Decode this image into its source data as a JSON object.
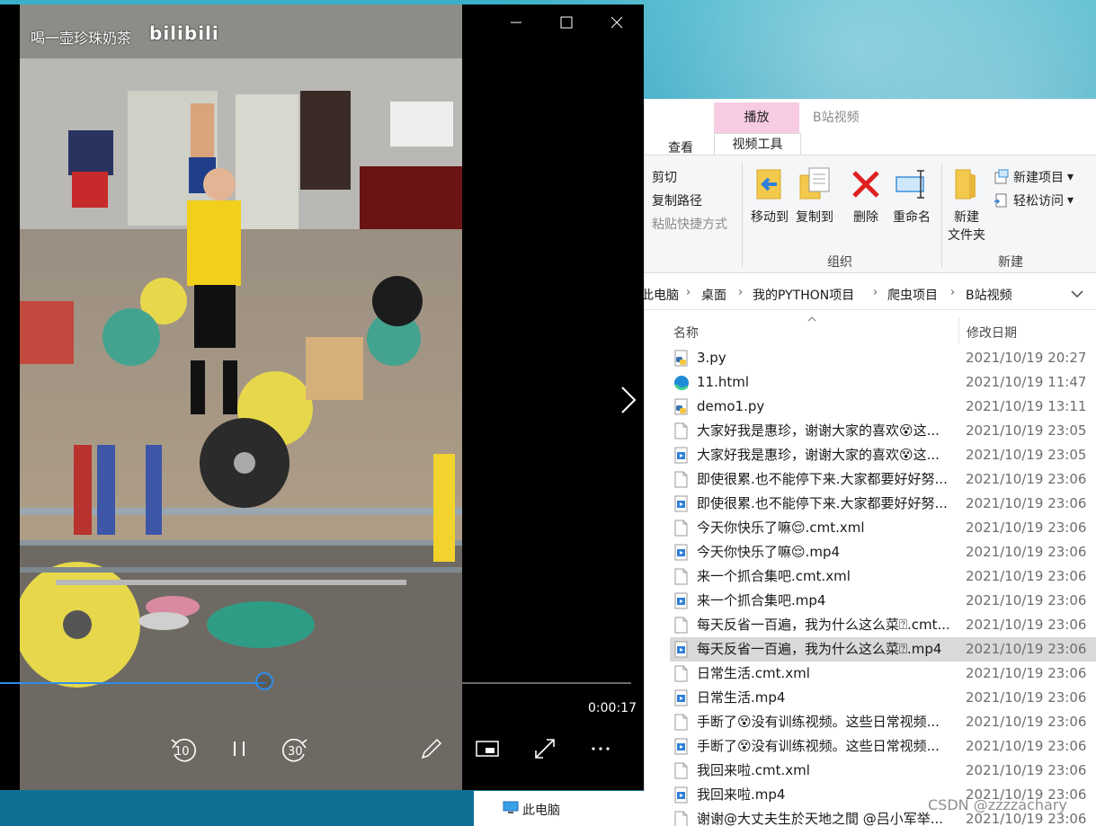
{
  "player": {
    "watermark_text": "喝一壶珍珠奶茶",
    "watermark_logo": "bilibili",
    "time_current": "0:00:17",
    "progress_fraction": 0.42,
    "accent_color": "#2f8ee8",
    "controls": {
      "rewind_seconds": "10",
      "forward_seconds": "30"
    },
    "icons": [
      "minimize-icon",
      "maximize-icon",
      "close-icon",
      "next-icon",
      "rewind-10-icon",
      "pause-icon",
      "forward-30-icon",
      "edit-pen-icon",
      "mini-view-icon",
      "fullscreen-icon",
      "more-icon"
    ]
  },
  "explorer": {
    "tabs": {
      "view": "查看",
      "context_group": "播放",
      "video_tools": "视频工具",
      "window_title": "B站视频"
    },
    "ribbon": {
      "clipboard": {
        "cut": "剪切",
        "copy_path": "复制路径",
        "paste_shortcut": "粘贴快捷方式"
      },
      "organize": {
        "move_to": "移动到",
        "copy_to": "复制到",
        "delete": "删除",
        "rename": "重命名",
        "group_label": "组织"
      },
      "new": {
        "new_folder_line1": "新建",
        "new_folder_line2": "文件夹",
        "new_item": "新建项目",
        "easy_access": "轻松访问",
        "group_label": "新建"
      }
    },
    "address": {
      "crumbs": [
        "此电脑",
        "桌面",
        "我的PYTHON项目",
        "爬虫项目",
        "B站视频"
      ]
    },
    "columns": {
      "name": "名称",
      "date": "修改日期"
    },
    "files": [
      {
        "name": "3.py",
        "date": "2021/10/19 20:27",
        "icon": "python-file-icon"
      },
      {
        "name": "11.html",
        "date": "2021/10/19 11:47",
        "icon": "edge-html-icon"
      },
      {
        "name": "demo1.py",
        "date": "2021/10/19 13:11",
        "icon": "python-file-icon"
      },
      {
        "name": "大家好我是惠珍，谢谢大家的喜欢😵这...",
        "date": "2021/10/19 23:05",
        "icon": "text-file-icon"
      },
      {
        "name": "大家好我是惠珍，谢谢大家的喜欢😵这...",
        "date": "2021/10/19 23:05",
        "icon": "video-file-icon"
      },
      {
        "name": "即使很累.也不能停下来.大家都要好好努...",
        "date": "2021/10/19 23:06",
        "icon": "text-file-icon"
      },
      {
        "name": "即使很累.也不能停下来.大家都要好好努...",
        "date": "2021/10/19 23:06",
        "icon": "video-file-icon"
      },
      {
        "name": "今天你快乐了嘛😌.cmt.xml",
        "date": "2021/10/19 23:06",
        "icon": "text-file-icon"
      },
      {
        "name": "今天你快乐了嘛😌.mp4",
        "date": "2021/10/19 23:06",
        "icon": "video-file-icon"
      },
      {
        "name": "来一个抓合集吧.cmt.xml",
        "date": "2021/10/19 23:06",
        "icon": "text-file-icon"
      },
      {
        "name": "来一个抓合集吧.mp4",
        "date": "2021/10/19 23:06",
        "icon": "video-file-icon"
      },
      {
        "name": "每天反省一百遍，我为什么这么菜⍰.cmt...",
        "date": "2021/10/19 23:06",
        "icon": "text-file-icon"
      },
      {
        "name": "每天反省一百遍，我为什么这么菜⍰.mp4",
        "date": "2021/10/19 23:06",
        "icon": "video-file-icon",
        "selected": true
      },
      {
        "name": "日常生活.cmt.xml",
        "date": "2021/10/19 23:06",
        "icon": "text-file-icon"
      },
      {
        "name": "日常生活.mp4",
        "date": "2021/10/19 23:06",
        "icon": "video-file-icon"
      },
      {
        "name": "手断了😵没有训练视频。这些日常视频...",
        "date": "2021/10/19 23:06",
        "icon": "text-file-icon"
      },
      {
        "name": "手断了😵没有训练视频。这些日常视频...",
        "date": "2021/10/19 23:06",
        "icon": "video-file-icon"
      },
      {
        "name": "我回来啦.cmt.xml",
        "date": "2021/10/19 23:06",
        "icon": "text-file-icon"
      },
      {
        "name": "我回来啦.mp4",
        "date": "2021/10/19 23:06",
        "icon": "video-file-icon"
      },
      {
        "name": "谢谢@大丈夫生於天地之間 @吕小军举...",
        "date": "2021/10/19 23:06",
        "icon": "text-file-icon"
      }
    ],
    "nav_pane": {
      "this_pc": "此电脑"
    }
  },
  "overlay": {
    "watermark": "CSDN @zzzzachary"
  }
}
